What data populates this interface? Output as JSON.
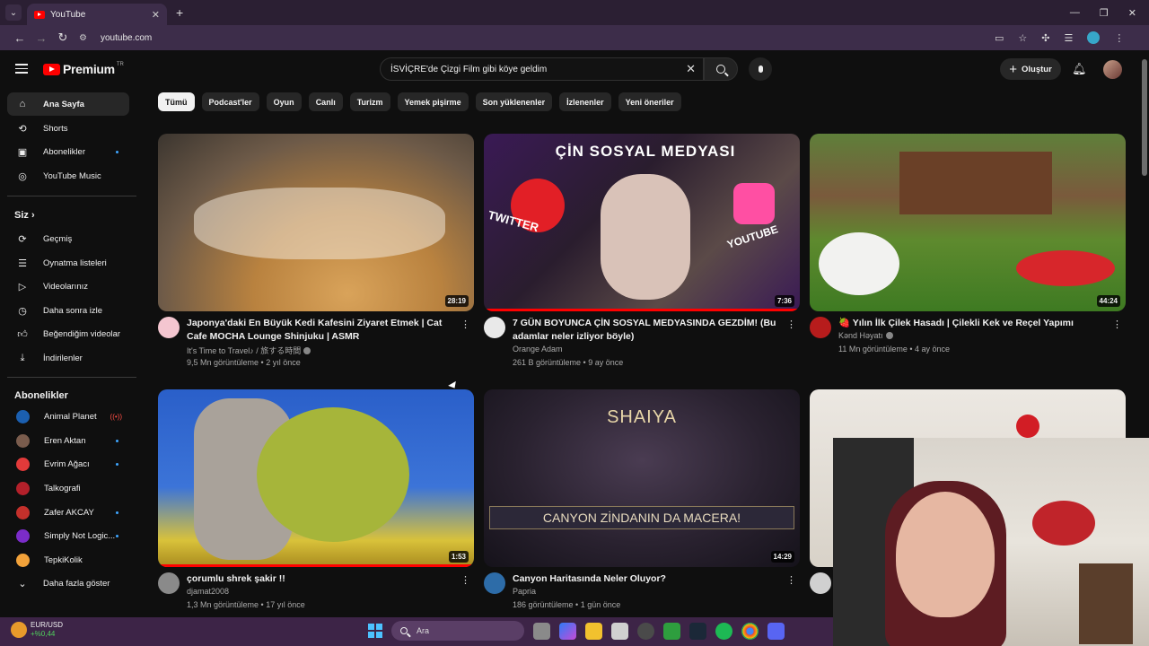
{
  "browser": {
    "tab_title": "YouTube",
    "url": "youtube.com",
    "menu_icon": "chevron-down",
    "new_tab": "+",
    "close": "✕"
  },
  "header": {
    "logo_text": "Premium",
    "logo_badge": "TR",
    "search_value": "İSVİÇRE'de Çizgi Film gibi köye geldim",
    "create_label": "Oluştur"
  },
  "sidebar": {
    "main": [
      {
        "label": "Ana Sayfa",
        "icon": "home-icon"
      },
      {
        "label": "Shorts",
        "icon": "shorts-icon"
      },
      {
        "label": "Abonelikler",
        "icon": "subscriptions-icon"
      },
      {
        "label": "YouTube Music",
        "icon": "music-icon"
      }
    ],
    "you_heading": "Siz",
    "you": [
      {
        "label": "Geçmiş",
        "icon": "history-icon"
      },
      {
        "label": "Oynatma listeleri",
        "icon": "playlist-icon"
      },
      {
        "label": "Videolarınız",
        "icon": "your-videos-icon"
      },
      {
        "label": "Daha sonra izle",
        "icon": "watch-later-icon"
      },
      {
        "label": "Beğendiğim videolar",
        "icon": "liked-icon"
      },
      {
        "label": "İndirilenler",
        "icon": "download-icon"
      }
    ],
    "subs_heading": "Abonelikler",
    "subs": [
      {
        "label": "Animal Planet",
        "color": "#1b5fb0"
      },
      {
        "label": "Eren Aktan",
        "color": "#7a5c4d"
      },
      {
        "label": "Evrim Ağacı",
        "color": "#e23a3a"
      },
      {
        "label": "Talkografi",
        "color": "#b3202a"
      },
      {
        "label": "Zafer AKCAY",
        "color": "#c4302b"
      },
      {
        "label": "Simply Not Logic...",
        "color": "#7b2cc9"
      },
      {
        "label": "TepkiKolik",
        "color": "#f2a23a"
      }
    ],
    "more_label": "Daha fazla göster"
  },
  "chips": [
    "Tümü",
    "Podcast'ler",
    "Oyun",
    "Canlı",
    "Turizm",
    "Yemek pişirme",
    "Son yüklenenler",
    "İzlenenler",
    "Yeni öneriler"
  ],
  "videos": [
    {
      "title": "Japonya'daki En Büyük Kedi Kafesini Ziyaret Etmek | Cat Cafe MOCHA Lounge Shinjuku | ASMR",
      "channel": "It's Time to Travel♪ / 旅する時間",
      "stats": "9,5 Mn görüntüleme • 2 yıl önce",
      "duration": "28:19"
    },
    {
      "title": "7 GÜN BOYUNCA ÇİN SOSYAL MEDYASINDA GEZDİM! (Bu adamlar neler izliyor böyle)",
      "channel": "Orange Adam",
      "stats": "261 B görüntüleme • 9 ay önce",
      "duration": "7:36",
      "thumb_text": "ÇİN SOSYAL MEDYASI",
      "thumb_left": "TWITTER",
      "thumb_right": "YOUTUBE"
    },
    {
      "title": "🍓 Yılın İlk Çilek Hasadı | Çilekli Kek ve Reçel Yapımı",
      "channel": "Kənd Həyatı",
      "stats": "11 Mn görüntüleme • 4 ay önce",
      "duration": "44:24"
    },
    {
      "title": "çorumlu shrek şakir !!",
      "channel": "djamat2008",
      "stats": "1,3 Mn görüntüleme • 17 yıl önce",
      "duration": "1:53"
    },
    {
      "title": "Canyon Haritasında Neler Oluyor?",
      "channel": "Papria",
      "stats": "186 görüntüleme • 1 gün önce",
      "duration": "14:29",
      "thumb_text": "SHAIYA",
      "thumb_banner": "CANYON ZİNDANIN DA MACERA!"
    }
  ],
  "taskbar": {
    "widget_title": "EUR/USD",
    "widget_sub": "+%0,44",
    "search_placeholder": "Ara"
  }
}
